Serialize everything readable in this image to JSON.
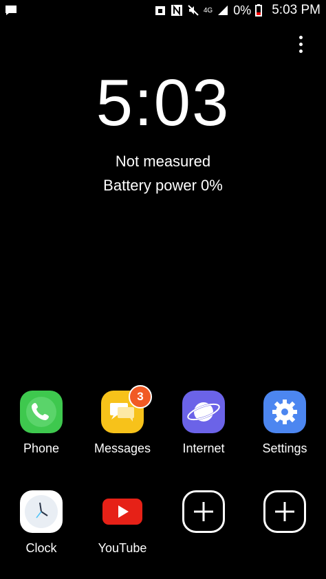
{
  "status_bar": {
    "battery_text": "0%",
    "time": "5:03 PM",
    "network": "4G"
  },
  "lock": {
    "time": "5:03",
    "steps_text": "Not measured",
    "battery_text": "Battery power 0%"
  },
  "apps": {
    "row1": [
      {
        "label": "Phone",
        "icon": "phone-icon",
        "color": "#3ec84e"
      },
      {
        "label": "Messages",
        "icon": "messages-icon",
        "color": "#f7c21a",
        "badge": "3"
      },
      {
        "label": "Internet",
        "icon": "internet-icon",
        "color": "#6b63e8"
      },
      {
        "label": "Settings",
        "icon": "settings-icon",
        "color": "#4c86f0"
      }
    ],
    "row2": [
      {
        "label": "Clock",
        "icon": "clock-icon",
        "color": "#ffffff"
      },
      {
        "label": "YouTube",
        "icon": "youtube-icon",
        "color": "#e62117"
      },
      {
        "label": "",
        "icon": "add-icon",
        "color": "#000000"
      },
      {
        "label": "",
        "icon": "add-icon",
        "color": "#000000"
      }
    ]
  }
}
